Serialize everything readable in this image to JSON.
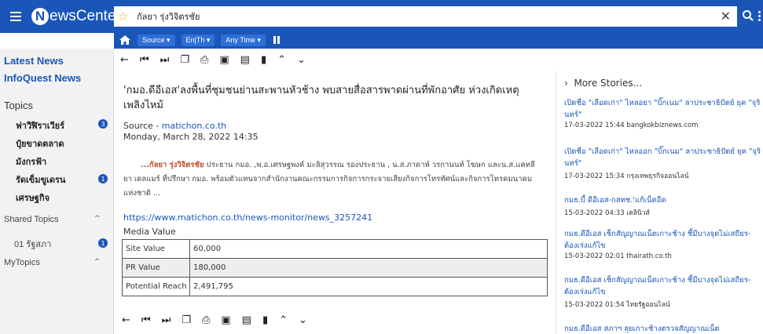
{
  "app": {
    "name_rest": "ewsCenter",
    "logo_letter": "N"
  },
  "search": {
    "value": "กัลยา รุ่งวิจิตรชัย",
    "placeholder": ""
  },
  "subbar": {
    "source": "Source ▾",
    "lang": "En|Th ▾",
    "time": "Any Time ▾"
  },
  "sidebar": {
    "latest": "Latest News",
    "infoquest": "InfoQuest News",
    "topics_label": "Topics",
    "topics": [
      {
        "label": "ฟาวิฬิราเวียร์",
        "badge": "3"
      },
      {
        "label": "ปุ๋ยขาดตลาด",
        "badge": ""
      },
      {
        "label": "มังกรฟ้า",
        "badge": ""
      },
      {
        "label": "รัดเข็มขูเดรน",
        "badge": "1"
      },
      {
        "label": "เศรษฐกิจ",
        "badge": ""
      }
    ],
    "shared_label": "Shared Topics",
    "shared_item": "01 รัฐสภา",
    "shared_badge": "1",
    "mytopics_label": "MyTopics"
  },
  "article": {
    "title": "'กมอ.ดีอีเอส'ลงพื้นที่ชุมชนย่านสะพานหัวช้าง พบสายสื่อสารพาดผ่านที่พักอาศัย ห่วงเกิดเหตุเพลิงไหม้",
    "source_label": "Source - ",
    "source_link": "matichon.co.th",
    "date": "Monday, March 28, 2022 14:35",
    "body_highlight": "...กัลยา รุ่งวิจิตรชัย",
    "body": " ประธาน กมอ. ,พ.อ.เศรษฐพงค์ มะลิสุวรรณ รองประธาน , น.ส.ภาดาห์ วรกานนท์ โฆษก และน.ส.แคทลียา เดลแมร์ ที่ปรึกษา กมอ. พร้อมตัวแทนจากสำนักงานคณะกรรมการกิจการกระจายเสียงกิจการโทรทัศน์และกิจการโทรคมนาคมแห่งชาติ ...",
    "url": "https://www.matichon.co.th/news-monitor/news_3257241",
    "media_value_label": "Media Value",
    "media": [
      {
        "label": "Site Value",
        "value": "60,000"
      },
      {
        "label": "PR Value",
        "value": "180,000"
      },
      {
        "label": "Potential Reach",
        "value": "2,491,795"
      }
    ]
  },
  "more": {
    "heading": "More Stories...",
    "stories": [
      {
        "title": "เปิดชื่อ \"เลือดเก่า\" ไหลอยา \"บิ๊กเนม\" ลาประชาธิปัตย์ ยุค \"จุรินทร์\"",
        "meta": "17-03-2022 15:44  bangkokbiznews.com"
      },
      {
        "title": "เปิดชื่อ \"เลือดเก่า\" ไหลออก \"บิ๊กเนม\" ลาประชาธิปัตย์ ยุค \"จุรินทร์\"",
        "meta": "17-03-2022 15:34  กรุงเทพธุรกิจออนไลน์"
      },
      {
        "title": "กมธ.บี้ ดีอีเอส-กสทช.'แก้เน็ตอืด",
        "meta": "15-03-2022 04:33  เดลินิวส์"
      },
      {
        "title": "กมธ.ดีอีเอส เช็กสัญญาณเน็ตเกาะช้าง ชี้มีบางจุดไม่เสถียร-ต้องเร่งแก้ไข",
        "meta": "15-03-2022 02:01  thairath.co.th"
      },
      {
        "title": "กมธ.ดีอีเอส เช็กสัญญาณเน็ตเกาะช้าง ชี้มีบางจุดไม่เสถียร-ต้องเร่งแก้ไข",
        "meta": "15-03-2022 01:54  ไทยรัฐออนไลน์"
      },
      {
        "title": "กมธ.ดีอีเอส สภาฯ ลุยเกาะช้างตรวจสัญญาณเน็ต",
        "meta": ""
      }
    ]
  }
}
